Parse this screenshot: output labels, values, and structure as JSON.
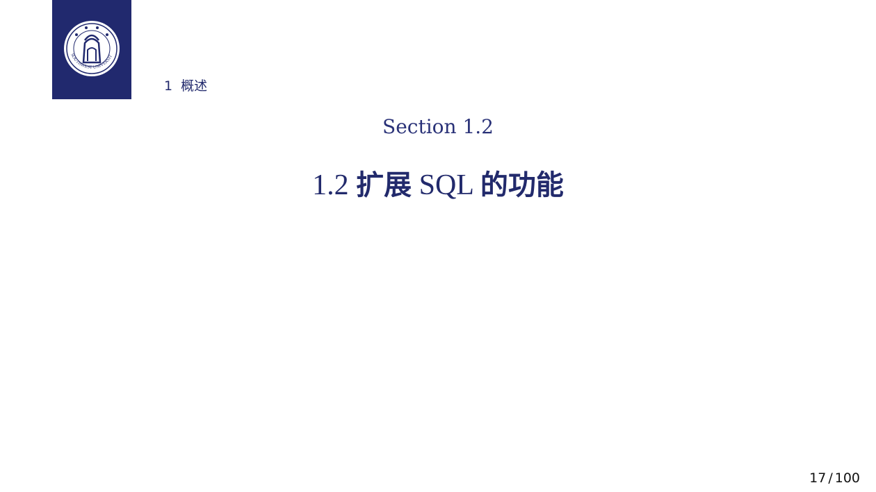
{
  "header": {
    "logo_text": "SOUTHWEST UNIVERSITY",
    "section_number": "1",
    "section_name": "概述"
  },
  "slide": {
    "subtitle": "Section 1.2",
    "title_parts": [
      "1.2 ",
      "扩展",
      " SQL ",
      "的功能"
    ]
  },
  "footer": {
    "page_current": "17",
    "page_separator": "/",
    "page_total": "100"
  },
  "colors": {
    "brand": "#21296e",
    "text": "#222a6c"
  }
}
